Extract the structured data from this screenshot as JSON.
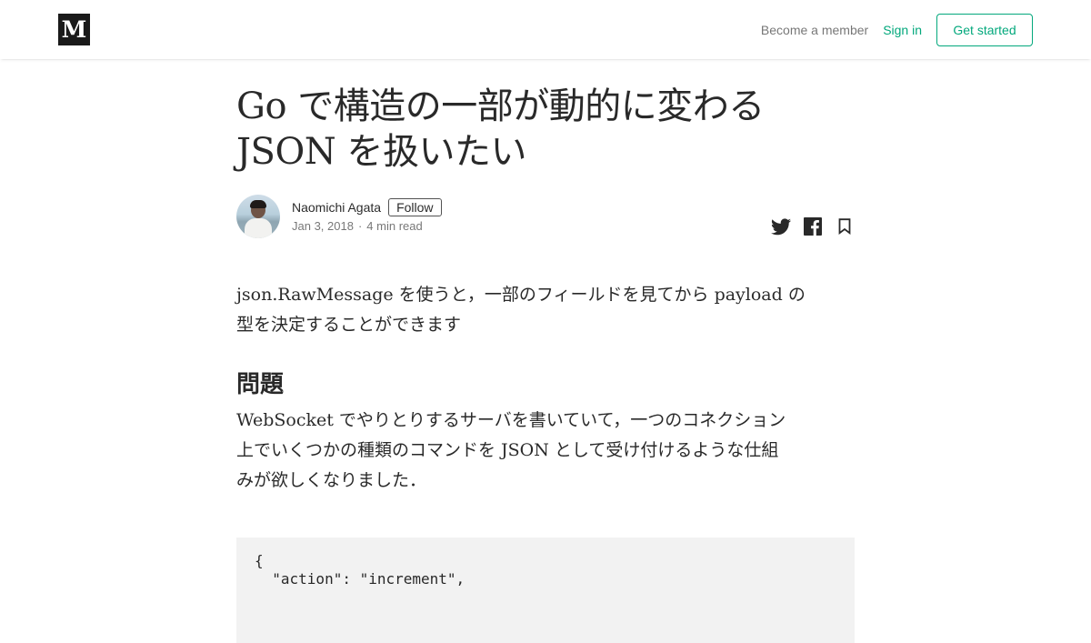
{
  "header": {
    "logo_letter": "M",
    "become_member": "Become a member",
    "sign_in": "Sign in",
    "get_started": "Get started",
    "accent_color": "#03a87c"
  },
  "article": {
    "title_line1": "Go で構造の一部が動的に変わる",
    "title_line2": "JSON を扱いたい",
    "author": "Naomichi Agata",
    "follow": "Follow",
    "date": "Jan 3, 2018",
    "separator": "·",
    "read_time": "4 min read",
    "share_icons": [
      "twitter-icon",
      "facebook-icon",
      "bookmark-icon"
    ],
    "lead_line1": "json.RawMessage を使うと，一部のフィールドを見てから payload の",
    "lead_line2": "型を決定することができます",
    "heading": "問題",
    "para_line1": "WebSocket でやりとりするサーバを書いていて，一つのコネクション",
    "para_line2": "上でいくつかの種類のコマンドを JSON として受け付けるような仕組",
    "para_line3": "みが欲しくなりました．",
    "code_line1": "{",
    "code_line2": "  \"action\": \"increment\","
  }
}
